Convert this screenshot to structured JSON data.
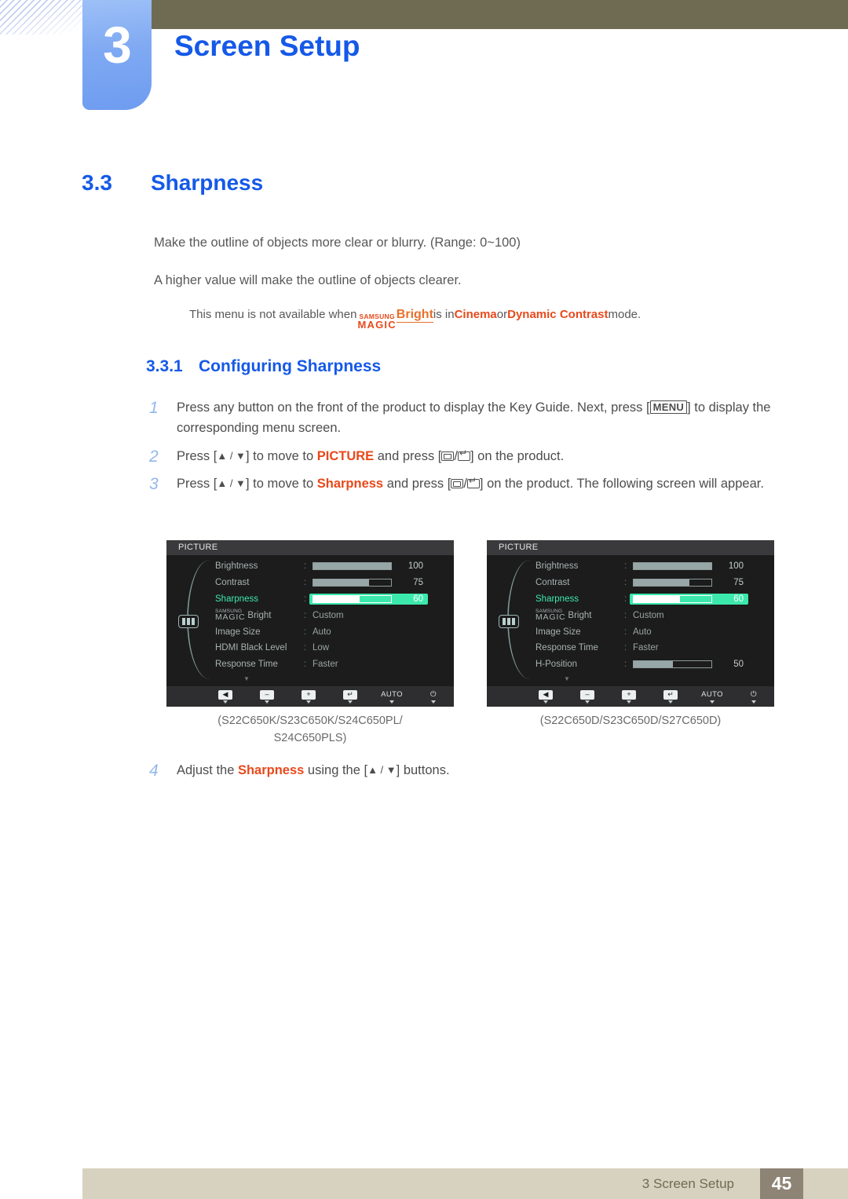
{
  "header": {
    "chapter_number": "3",
    "chapter_title": "Screen Setup"
  },
  "section": {
    "number": "3.3",
    "title": "Sharpness"
  },
  "body": {
    "paragraph_1": "Make the outline of objects more clear or blurry. (Range: 0~100)",
    "paragraph_2": "A higher value will make the outline of objects clearer.",
    "note": {
      "prefix": "This menu is not available when ",
      "logo_top": "SAMSUNG",
      "logo_bottom": "MAGIC",
      "logo_word": "Bright",
      "middle": " is in ",
      "mode_1": "Cinema",
      "conjunction": " or ",
      "mode_2": "Dynamic Contrast",
      "suffix": " mode."
    }
  },
  "subsection": {
    "number": "3.3.1",
    "title": "Configuring Sharpness"
  },
  "steps": [
    {
      "number": "1",
      "part_1": "Press any button on the front of the product to display the Key Guide. Next, press [",
      "key": "MENU",
      "part_2": "] to display the corresponding menu screen."
    },
    {
      "number": "2",
      "part_1": "Press [",
      "arrows": "▲ / ▼",
      "part_2": "] to move to ",
      "highlight": "PICTURE",
      "part_3": " and press [",
      "part_4": "] on the product."
    },
    {
      "number": "3",
      "part_1": "Press [",
      "arrows": "▲ / ▼",
      "part_2": "] to move to ",
      "highlight": "Sharpness",
      "part_3": " and press [",
      "part_4": "] on the product. The following screen will appear."
    },
    {
      "number": "4",
      "part_1": "Adjust the ",
      "highlight": "Sharpness",
      "part_2": " using the [",
      "arrows": "▲ / ▼",
      "part_3": "] buttons."
    }
  ],
  "osd_left": {
    "title": "PICTURE",
    "caption": "(S22C650K/S23C650K/S24C650PL/\nS24C650PLS)",
    "rows": [
      {
        "label": "Brightness",
        "type": "slider",
        "value": 100,
        "fill_pct": 100,
        "selected": false
      },
      {
        "label": "Contrast",
        "type": "slider",
        "value": 75,
        "fill_pct": 72,
        "selected": false
      },
      {
        "label": "Sharpness",
        "type": "slider",
        "value": 60,
        "fill_pct": 60,
        "selected": true
      },
      {
        "label": "MAGIC Bright",
        "type": "text",
        "value": "Custom",
        "selected": false,
        "logo": true
      },
      {
        "label": "Image Size",
        "type": "text",
        "value": "Auto",
        "selected": false
      },
      {
        "label": "HDMI Black Level",
        "type": "text",
        "value": "Low",
        "selected": false
      },
      {
        "label": "Response Time",
        "type": "text",
        "value": "Faster",
        "selected": false
      }
    ],
    "buttons": [
      {
        "name": "back",
        "glyph": "◀",
        "kind": "icon"
      },
      {
        "name": "minus",
        "glyph": "–",
        "kind": "icon"
      },
      {
        "name": "plus",
        "glyph": "+",
        "kind": "icon"
      },
      {
        "name": "enter",
        "glyph": "↵",
        "kind": "icon"
      },
      {
        "name": "auto",
        "glyph": "AUTO",
        "kind": "text"
      },
      {
        "name": "power",
        "glyph": "⏻",
        "kind": "text"
      }
    ]
  },
  "osd_right": {
    "title": "PICTURE",
    "caption": "(S22C650D/S23C650D/S27C650D)",
    "rows": [
      {
        "label": "Brightness",
        "type": "slider",
        "value": 100,
        "fill_pct": 100,
        "selected": false
      },
      {
        "label": "Contrast",
        "type": "slider",
        "value": 75,
        "fill_pct": 72,
        "selected": false
      },
      {
        "label": "Sharpness",
        "type": "slider",
        "value": 60,
        "fill_pct": 60,
        "selected": true
      },
      {
        "label": "MAGIC Bright",
        "type": "text",
        "value": "Custom",
        "selected": false,
        "logo": true
      },
      {
        "label": "Image Size",
        "type": "text",
        "value": "Auto",
        "selected": false
      },
      {
        "label": "Response Time",
        "type": "text",
        "value": "Faster",
        "selected": false
      },
      {
        "label": "H-Position",
        "type": "slider",
        "value": 50,
        "fill_pct": 50,
        "selected": false
      }
    ],
    "buttons": [
      {
        "name": "back",
        "glyph": "◀",
        "kind": "icon"
      },
      {
        "name": "minus",
        "glyph": "–",
        "kind": "icon"
      },
      {
        "name": "plus",
        "glyph": "+",
        "kind": "icon"
      },
      {
        "name": "enter",
        "glyph": "↵",
        "kind": "icon"
      },
      {
        "name": "auto",
        "glyph": "AUTO",
        "kind": "text"
      },
      {
        "name": "power",
        "glyph": "⏻",
        "kind": "text"
      }
    ]
  },
  "footer": {
    "text": "3 Screen Setup",
    "page": "45"
  },
  "colors": {
    "heading_blue": "#1559e8",
    "accent_red": "#e8491b",
    "olive": "#6f6b52",
    "tab_blue": "#7fa9f2",
    "footer_bg": "#d6d2bf",
    "page_badge": "#8d8475",
    "osd_bg": "#1c1c1c",
    "osd_highlight": "#3ce9ad"
  }
}
